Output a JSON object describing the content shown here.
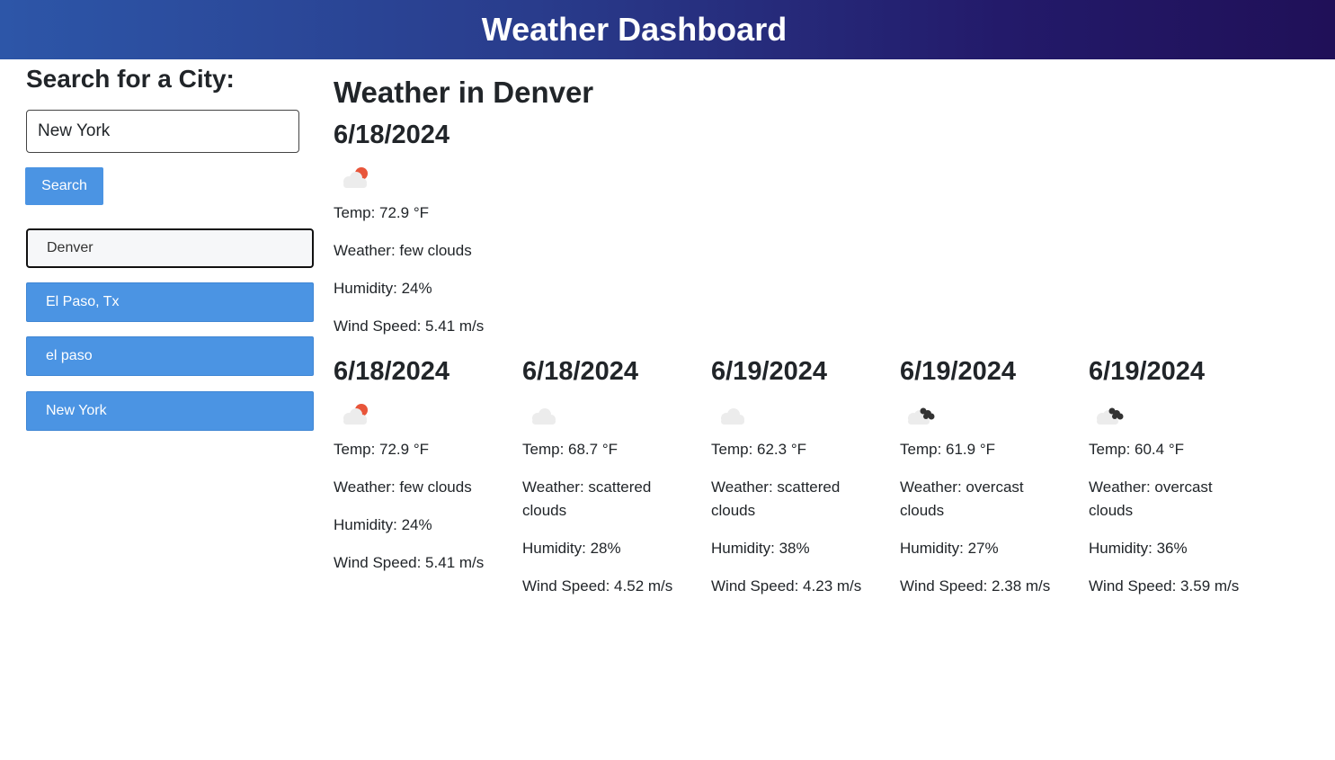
{
  "header": {
    "title": "Weather Dashboard"
  },
  "sidebar": {
    "heading": "Search for a City:",
    "search_value": "New York",
    "search_button": "Search",
    "history": [
      {
        "label": "Denver",
        "active": true
      },
      {
        "label": "El Paso, Tx",
        "active": false
      },
      {
        "label": "el paso",
        "active": false
      },
      {
        "label": "New York",
        "active": false
      }
    ]
  },
  "current": {
    "heading": "Weather in Denver",
    "date": "6/18/2024",
    "icon": "few-clouds-day-icon",
    "temp": "Temp: 72.9 °F",
    "weather": "Weather: few clouds",
    "humidity": "Humidity: 24%",
    "wind": "Wind Speed: 5.41 m/s"
  },
  "forecast": [
    {
      "date": "6/18/2024",
      "icon": "few-clouds-day-icon",
      "temp": "Temp: 72.9 °F",
      "weather": "Weather: few clouds",
      "humidity": "Humidity: 24%",
      "wind": "Wind Speed: 5.41 m/s"
    },
    {
      "date": "6/18/2024",
      "icon": "scattered-clouds-icon",
      "temp": "Temp: 68.7 °F",
      "weather": "Weather: scattered clouds",
      "humidity": "Humidity: 28%",
      "wind": "Wind Speed: 4.52 m/s"
    },
    {
      "date": "6/19/2024",
      "icon": "scattered-clouds-icon",
      "temp": "Temp: 62.3 °F",
      "weather": "Weather: scattered clouds",
      "humidity": "Humidity: 38%",
      "wind": "Wind Speed: 4.23 m/s"
    },
    {
      "date": "6/19/2024",
      "icon": "overcast-clouds-icon",
      "temp": "Temp: 61.9 °F",
      "weather": "Weather: overcast clouds",
      "humidity": "Humidity: 27%",
      "wind": "Wind Speed: 2.38 m/s"
    },
    {
      "date": "6/19/2024",
      "icon": "overcast-clouds-icon",
      "temp": "Temp: 60.4 °F",
      "weather": "Weather: overcast clouds",
      "humidity": "Humidity: 36%",
      "wind": "Wind Speed: 3.59 m/s"
    }
  ],
  "colors": {
    "header_gradient_start": "#2d56a8",
    "header_gradient_end": "#201058",
    "button_blue": "#4b94e3",
    "sun_orange": "#e8553a"
  }
}
